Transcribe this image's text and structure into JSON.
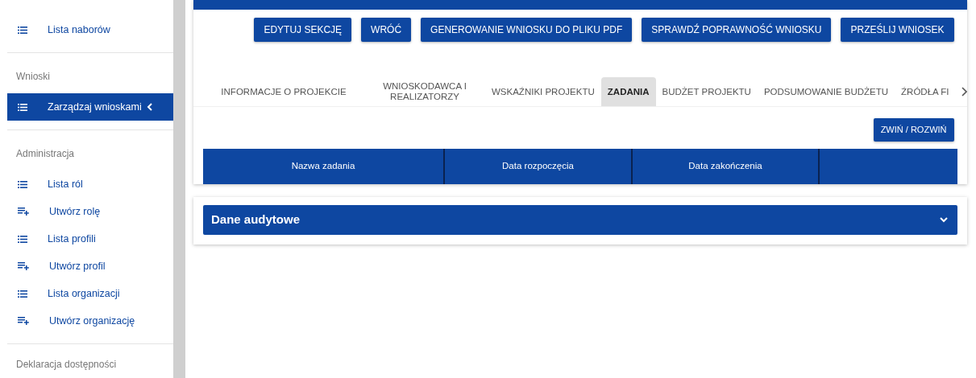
{
  "sidebar": {
    "sections": [
      {
        "items": [
          {
            "label": "Lista naborów",
            "kind": "list",
            "selected": false
          }
        ]
      },
      {
        "header": "Wnioski",
        "items": [
          {
            "label": "Zarządzaj wnioskami",
            "kind": "list",
            "selected": true,
            "submenu_open": true
          }
        ]
      },
      {
        "header": "Administracja",
        "items": [
          {
            "label": "Lista ról",
            "kind": "list",
            "selected": false
          },
          {
            "label": "Utwórz rolę",
            "kind": "create",
            "selected": false
          },
          {
            "label": "Lista profili",
            "kind": "list",
            "selected": false
          },
          {
            "label": "Utwórz profil",
            "kind": "create",
            "selected": false
          },
          {
            "label": "Lista organizacji",
            "kind": "list",
            "selected": false
          },
          {
            "label": "Utwórz organizację",
            "kind": "create",
            "selected": false
          }
        ]
      },
      {
        "header": "Deklaracja dostępności"
      }
    ]
  },
  "actions": [
    "EDYTUJ SEKCJĘ",
    "WRÓĆ",
    "GENEROWANIE WNIOSKU DO PLIKU PDF",
    "SPRAWDŹ POPRAWNOŚĆ WNIOSKU",
    "PRZEŚLIJ WNIOSEK"
  ],
  "tabs": [
    {
      "label": "INFORMACJE O PROJEKCIE",
      "selected": false
    },
    {
      "label": "WNIOSKODAWCA I REALIZATORZY",
      "selected": false
    },
    {
      "label": "WSKAŹNIKI PROJEKTU",
      "selected": false
    },
    {
      "label": "ZADANIA",
      "selected": true
    },
    {
      "label": "BUDŻET PROJEKTU",
      "selected": false
    },
    {
      "label": "PODSUMOWANIE BUDŻETU",
      "selected": false
    },
    {
      "label": "ŹRÓDŁA FI",
      "selected": false
    }
  ],
  "toggle_button": "ZWIŃ / ROZWIŃ",
  "table": {
    "columns": [
      "Nazwa zadania",
      "Data rozpoczęcia",
      "Data zakończenia",
      ""
    ]
  },
  "audit_panel": {
    "title": "Dane audytowe",
    "expanded": false
  }
}
